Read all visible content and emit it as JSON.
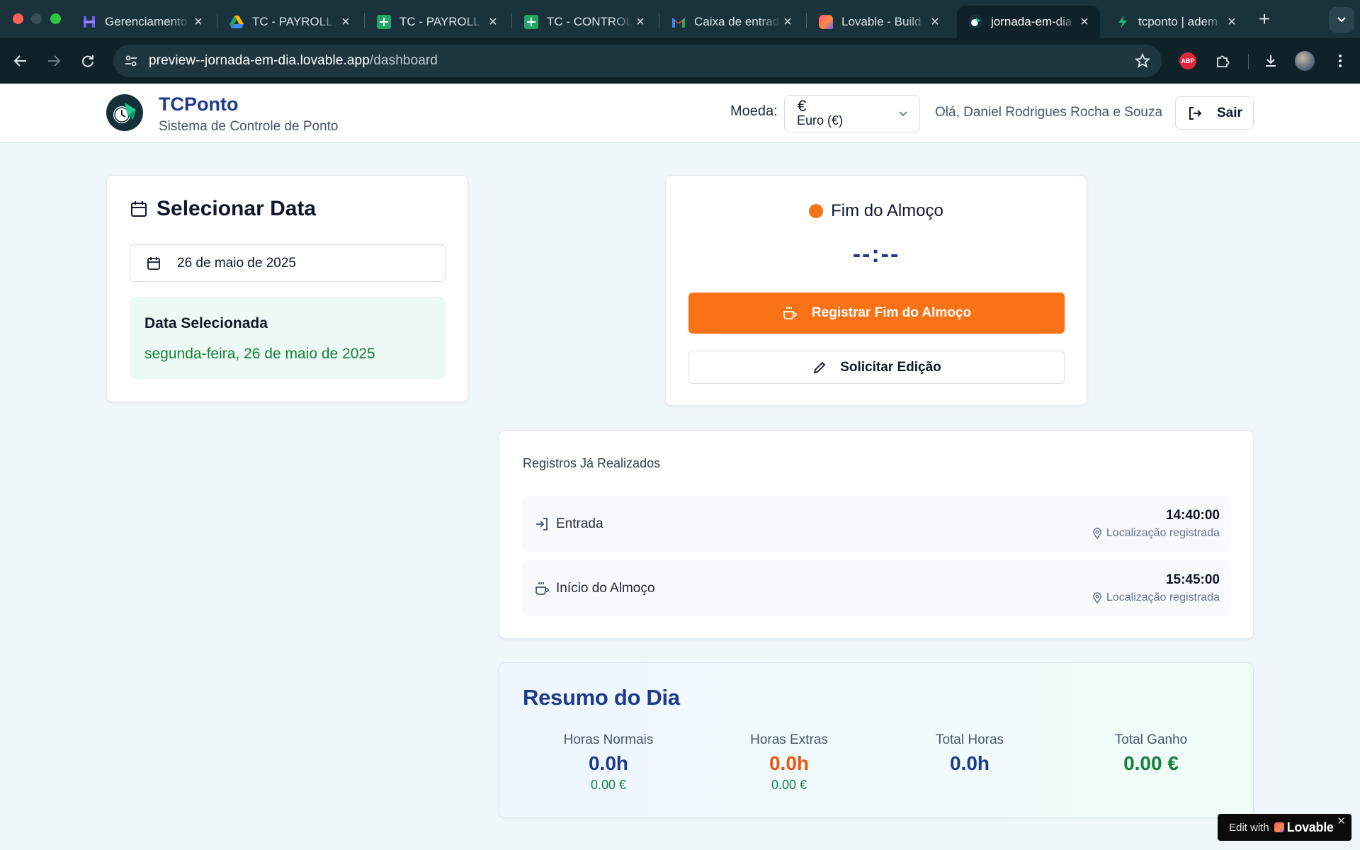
{
  "browser": {
    "tabs": [
      {
        "title": "Gerenciamento",
        "favicon": "hubspot-icon",
        "color": "#6d5dfc"
      },
      {
        "title": "TC - PAYROLL",
        "favicon": "google-drive-icon",
        "color": "#1fa463"
      },
      {
        "title": "TC - PAYROLL",
        "favicon": "google-sheets-icon",
        "color": "#23a566"
      },
      {
        "title": "TC - CONTROL",
        "favicon": "google-sheets-icon",
        "color": "#23a566"
      },
      {
        "title": "Caixa de entrada",
        "favicon": "gmail-icon",
        "color": "#ea4335"
      },
      {
        "title": "Lovable - Build",
        "favicon": "lovable-icon",
        "color": "#ff4f7b"
      },
      {
        "title": "jornada-em-dia",
        "favicon": "app-logo-icon",
        "color": "#16303a"
      },
      {
        "title": "tcponto | adem",
        "favicon": "bolt-icon",
        "color": "#1fbf6a"
      }
    ],
    "url_host": "preview--jornada-em-dia.lovable.app",
    "url_path": "/dashboard"
  },
  "header": {
    "brand_title": "TCPonto",
    "brand_subtitle": "Sistema de Controle de Ponto",
    "currency_label": "Moeda:",
    "currency_symbol": "€",
    "currency_value": "Euro (€)",
    "greeting": "Olá, Daniel Rodrigues Rocha e Souza",
    "logout_label": "Sair"
  },
  "date_card": {
    "title": "Selecionar Data",
    "date_value": "26 de maio de 2025",
    "selected_heading": "Data Selecionada",
    "selected_full": "segunda-feira, 26 de maio de 2025"
  },
  "punch": {
    "status_label": "Fim do Almoço",
    "status_color": "#f97316",
    "time_display": "--:--",
    "register_button": "Registrar Fim do Almoço",
    "edit_button": "Solicitar Edição"
  },
  "records": {
    "title": "Registros Já Realizados",
    "items": [
      {
        "label": "Entrada",
        "time": "14:40:00",
        "location": "Localização registrada",
        "icon": "login-icon"
      },
      {
        "label": "Início do Almoço",
        "time": "15:45:00",
        "location": "Localização registrada",
        "icon": "coffee-icon"
      }
    ]
  },
  "summary": {
    "title": "Resumo do Dia",
    "stats": [
      {
        "label": "Horas Normais",
        "value": "0.0h",
        "sub": "0.00 €"
      },
      {
        "label": "Horas Extras",
        "value": "0.0h",
        "sub": "0.00 €"
      },
      {
        "label": "Total Horas",
        "value": "0.0h",
        "sub": ""
      },
      {
        "label": "Total Ganho",
        "value": "0.00 €",
        "sub": ""
      }
    ]
  },
  "badge": {
    "prefix": "Edit with",
    "brand": "Lovable",
    "close": "✕"
  },
  "colors": {
    "primary_orange": "#f97316",
    "navy": "#1e3a8a",
    "green": "#15803d"
  }
}
